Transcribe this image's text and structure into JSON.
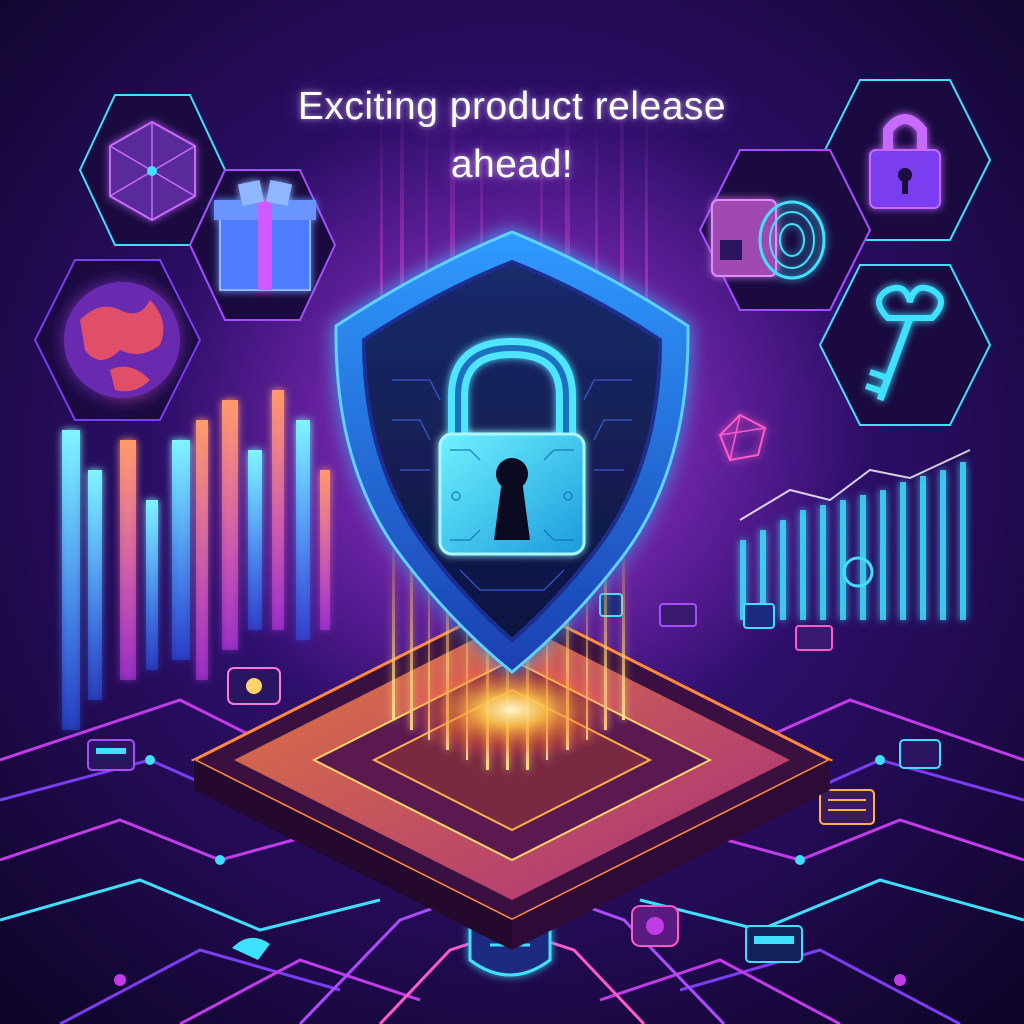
{
  "headline": {
    "line1": "Exciting product release",
    "line2": "ahead!"
  },
  "palette": {
    "background": "#12062e",
    "magenta": "#c23be8",
    "violet": "#7a3df0",
    "cyan": "#3fe0ff",
    "blue": "#2e7bff",
    "orange": "#ff8a3d",
    "gold": "#ffd36a"
  },
  "icons": {
    "shield": "shield-icon",
    "padlock": "padlock-icon",
    "keyhole": "keyhole-icon",
    "globe": "globe-icon",
    "gift": "gift-box-icon",
    "cube_network": "network-cube-icon",
    "small_lock": "lock-icon",
    "fingerprint": "fingerprint-icon",
    "key": "key-icon",
    "cpu": "cpu-chip-icon"
  }
}
